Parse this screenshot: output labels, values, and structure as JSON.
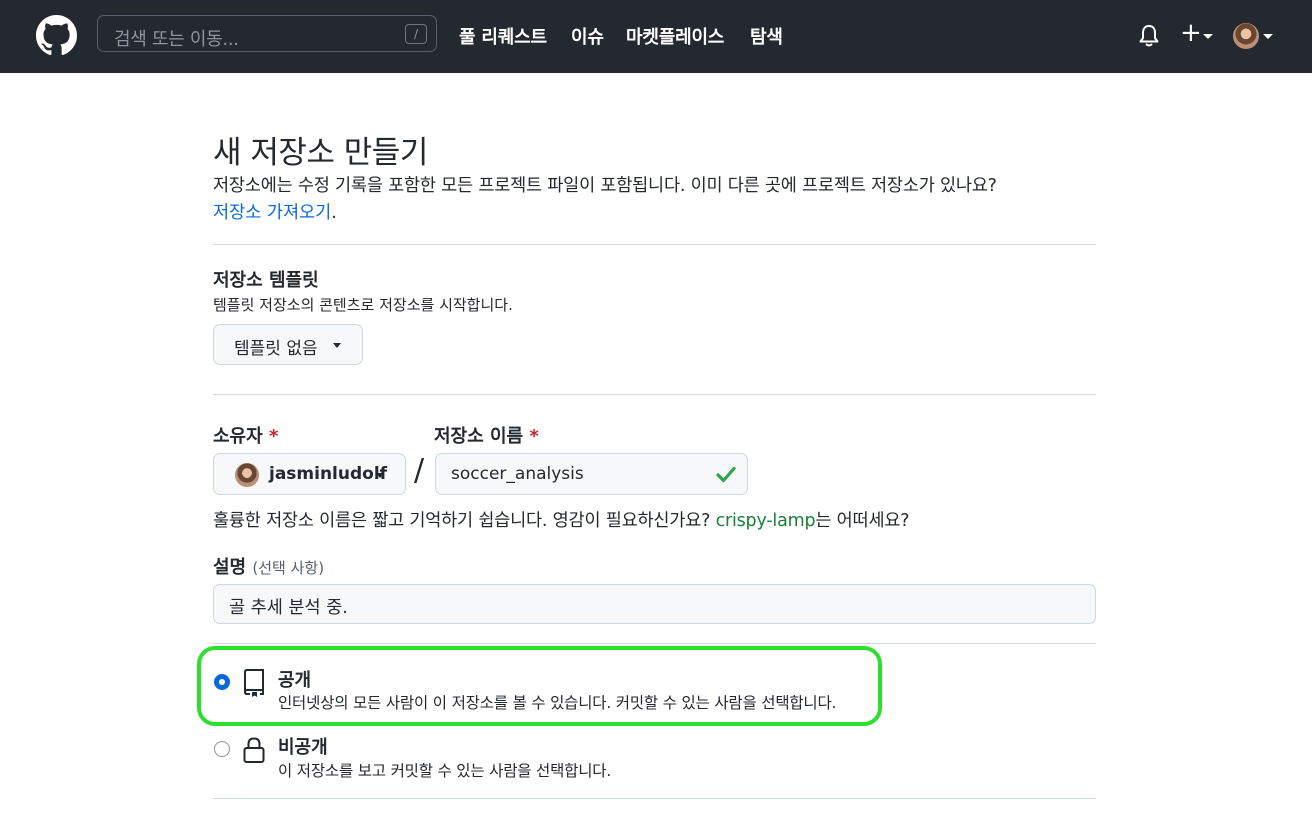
{
  "header": {
    "search_placeholder": "검색 또는 이동...",
    "search_shortcut": "/",
    "nav": [
      "풀 리퀘스트",
      "이슈",
      "마켓플레이스",
      "탐색"
    ],
    "icons": [
      "github-logo-icon",
      "bell-icon",
      "plus-icon",
      "avatar"
    ]
  },
  "page": {
    "title": "새 저장소 만들기",
    "subtitle": "저장소에는 수정 기록을 포함한 모든 프로젝트 파일이 포함됩니다. 이미 다른 곳에 프로젝트 저장소가 있나요?",
    "import_link": "저장소 가져오기",
    "import_suffix": "."
  },
  "template": {
    "label": "저장소 템플릿",
    "description": "템플릿 저장소의 콘텐츠로 저장소를 시작합니다.",
    "selected": "템플릿 없음"
  },
  "owner": {
    "label": "소유자",
    "required_mark": "*",
    "value": "jasminludolf"
  },
  "repo_name": {
    "label": "저장소 이름",
    "required_mark": "*",
    "value": "soccer_analysis",
    "separator": "/"
  },
  "name_hint": {
    "before": "훌륭한 저장소 이름은 짧고 기억하기 쉽습니다. 영감이 필요하신가요? ",
    "suggestion": "crispy-lamp",
    "after": "는 어떠세요?"
  },
  "description": {
    "label": "설명",
    "optional": "(선택 사항)",
    "value": "골 추세 분석 중."
  },
  "visibility": {
    "public": {
      "title": "공개",
      "description": "인터넷상의 모든 사람이 이 저장소를 볼 수 있습니다. 커밋할 수 있는 사람을 선택합니다.",
      "selected": true
    },
    "private": {
      "title": "비공개",
      "description": "이 저장소를 보고 커밋할 수 있는 사람을 선택합니다.",
      "selected": false
    }
  },
  "colors": {
    "header_bg": "#24292f",
    "link": "#0969da",
    "success": "#1a7f37",
    "required": "#cf222e",
    "highlight": "#2ee02e"
  }
}
